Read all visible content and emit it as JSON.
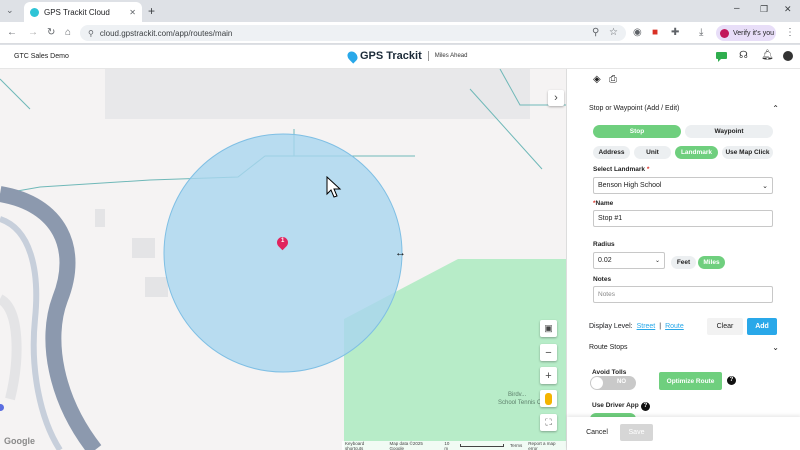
{
  "browser": {
    "tab_title": "GPS Trackit Cloud",
    "new_tab_symbol": "+",
    "url": "cloud.gpstrackit.com/app/routes/main",
    "verify_label": "Verify it's you"
  },
  "app": {
    "company": "GTC Sales Demo",
    "logo_text": "GPS Trackit",
    "tagline": "Miles Ahead"
  },
  "map": {
    "marker_number": "1",
    "poi_label_1": "Birdv...",
    "poi_label_2": "School Tennis C...",
    "google_logo": "Google",
    "attribution": {
      "shortcuts": "Keyboard shortcuts",
      "map_data": "Map data ©2025 Google",
      "scale": "10 m",
      "terms": "Terms",
      "report": "Report a map error"
    },
    "radius_miles": 0.02,
    "colors": {
      "circle": "#a9d6ef",
      "circle_border": "#7fbfe4",
      "marker": "#e0245e",
      "park": "#b7ecc8"
    }
  },
  "panel": {
    "section_title": "Stop or Waypoint (Add / Edit)",
    "type_options": [
      "Stop",
      "Waypoint"
    ],
    "selected_type": "Stop",
    "source_options": [
      "Address",
      "Unit",
      "Landmark",
      "Use Map Click"
    ],
    "selected_source": "Landmark",
    "landmark_label": "Select Landmark",
    "required_mark": "*",
    "landmark_value": "Benson High School",
    "name_label": "Name",
    "name_value": "Stop #1",
    "radius_label": "Radius",
    "radius_value": "0.02",
    "unit_options": [
      "Feet",
      "Miles"
    ],
    "selected_unit": "Miles",
    "notes_label": "Notes",
    "notes_placeholder": "Notes",
    "display_level_label": "Display Level:",
    "display_level_street": "Street",
    "display_level_sep": "|",
    "display_level_route": "Route",
    "clear_label": "Clear",
    "add_label": "Add",
    "route_stops_label": "Route Stops",
    "avoid_tolls_label": "Avoid Tolls",
    "avoid_tolls_state": "NO",
    "optimize_label": "Optimize Route",
    "help_symbol": "?",
    "use_driver_app_label": "Use Driver App",
    "cancel_label": "Cancel",
    "save_label": "Save",
    "colors": {
      "green": "#6fcf7e",
      "blue": "#29a8e9"
    }
  }
}
